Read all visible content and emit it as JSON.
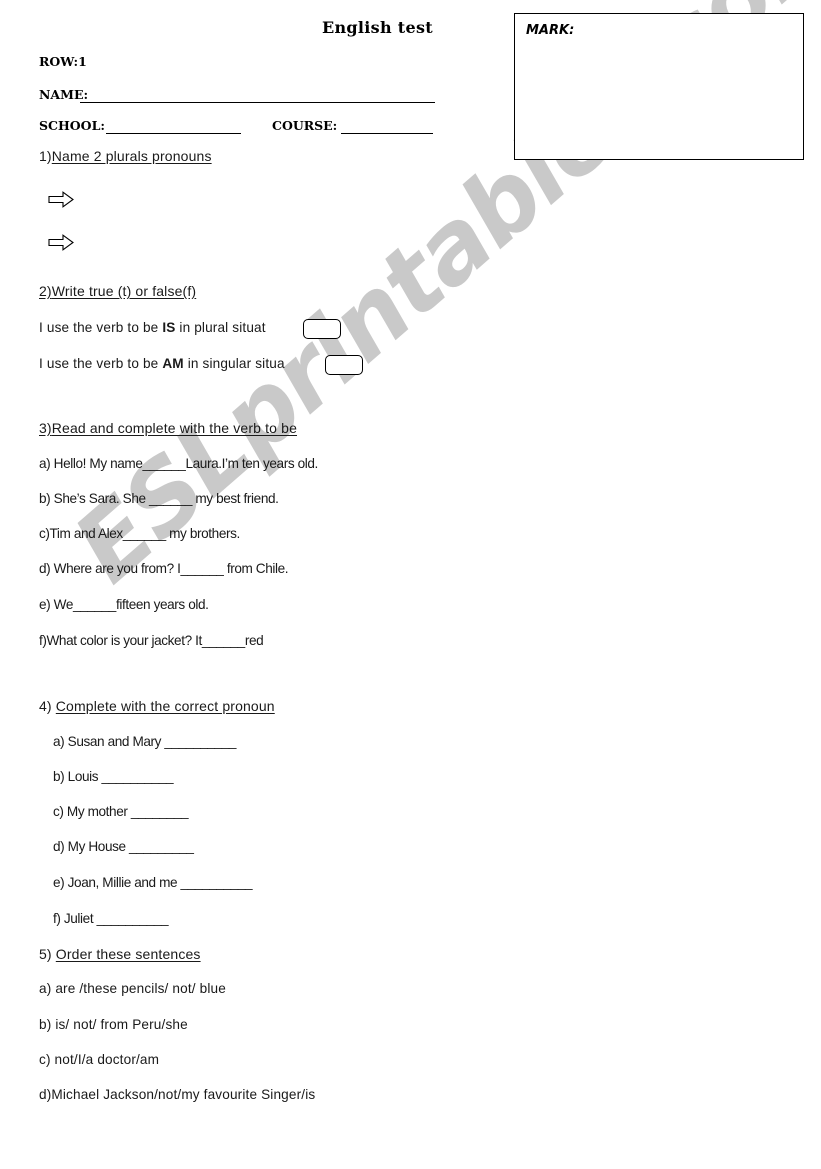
{
  "document": {
    "title": "English test",
    "watermark": "ESLprintables.com",
    "watermark_color": "#c9c9c9"
  },
  "header": {
    "row_label": "ROW:1",
    "name_label": "NAME:",
    "school_label": "SCHOOL:",
    "course_label": "COURSE:",
    "mark_label": "MARK:"
  },
  "sections": [
    {
      "number": "1)",
      "heading": "Name 2 plurals pronouns",
      "heading_underlined": "Name 2 plurals pronouns",
      "answer_arrows": 2
    },
    {
      "number": "2)",
      "heading": "Write true (t) or false(f)",
      "items": [
        {
          "text_before": "I use the verb to be ",
          "bold": "IS",
          "text_after": " in plural situat",
          "has_box": true
        },
        {
          "text_before": "I use the verb to be ",
          "bold": "AM",
          "text_after": " in singular situa",
          "has_box": true
        }
      ]
    },
    {
      "number": "3)",
      "heading": "Read  and complete with the verb to be",
      "items": [
        "a)  Hello!  My name______Laura.I’m ten years old.",
        "b) She’s Sara. She ______ my best friend.",
        "c)Tim and Alex______ my brothers.",
        "d) Where are you from? I______ from Chile.",
        "e) We______fifteen years old.",
        "f)What color is your jacket? It______red"
      ]
    },
    {
      "number": "4) ",
      "heading": "Complete  with the correct pronoun",
      "items": [
        "a) Susan and Mary  __________",
        "b) Louis  __________",
        "c) My mother  ________",
        "d) My House  _________",
        "e) Joan, Millie and me  __________",
        "f) Juliet  __________"
      ]
    },
    {
      "number": "5) ",
      "heading": "Order these sentences",
      "items": [
        "a) are /these pencils/ not/ blue",
        "b) is/ not/ from Peru/she",
        "c) not/I/a doctor/am",
        "d)Michael Jackson/not/my favourite Singer/is"
      ]
    }
  ]
}
